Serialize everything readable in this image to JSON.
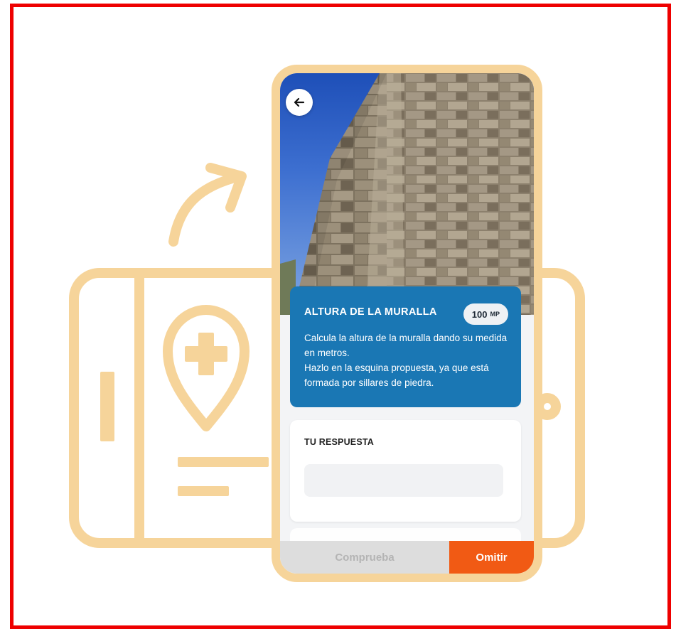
{
  "colors": {
    "frame_border": "#ee0000",
    "illustration": "#f6d49a",
    "card_blue": "#1a77b4",
    "skip_button": "#f15a14",
    "check_button": "#dddddd"
  },
  "header": {
    "back_icon": "arrow-left-icon"
  },
  "challenge": {
    "title": "ALTURA DE LA MURALLA",
    "points_value": "100",
    "points_unit": "MP",
    "description": "Calcula la altura de la muralla dando su medida en metros.\nHazlo en la esquina propuesta, ya que está formada por sillares de piedra."
  },
  "answer": {
    "label": "TU RESPUESTA",
    "value": "",
    "placeholder": ""
  },
  "actions": {
    "check_label": "Comprueba",
    "skip_label": "Omitir"
  }
}
